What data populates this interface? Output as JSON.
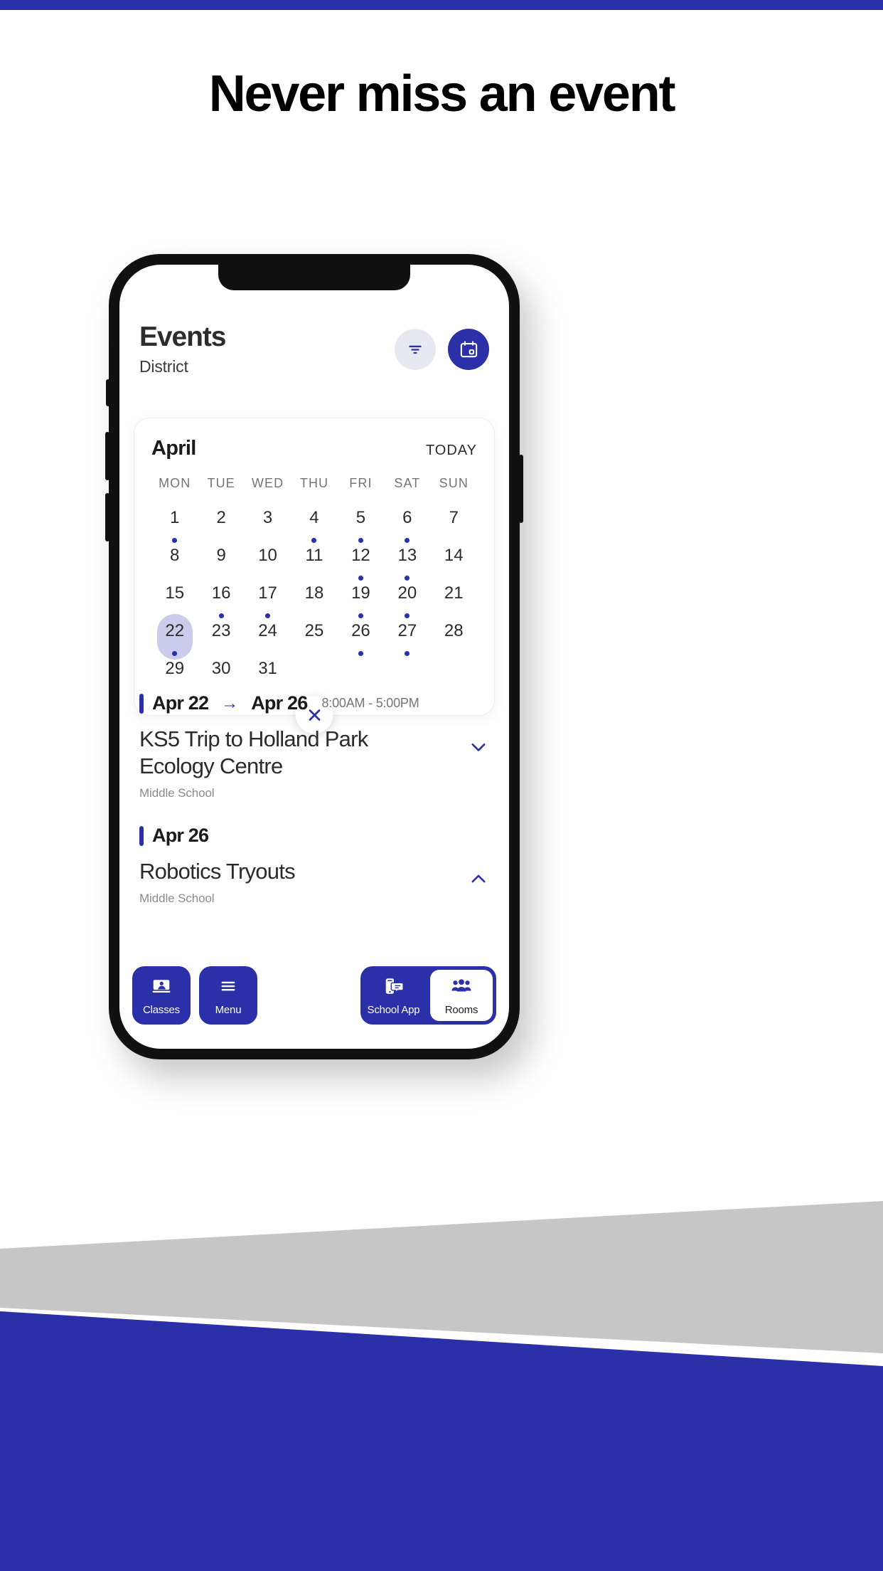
{
  "page": {
    "headline": "Never miss an event",
    "accent_blue": "#2b30a8",
    "selection_lavender": "#cbcceb",
    "band_gray": "#c6c6c6"
  },
  "app": {
    "title": "Events",
    "subtitle": "District",
    "actions": [
      {
        "name": "filter-icon",
        "style": "ghost"
      },
      {
        "name": "calendar-icon",
        "style": "solid"
      }
    ]
  },
  "calendar": {
    "month": "April",
    "today_label": "TODAY",
    "weekdays": [
      "MON",
      "TUE",
      "WED",
      "THU",
      "FRI",
      "SAT",
      "SUN"
    ],
    "selected_day": 22,
    "days_with_events": [
      1,
      4,
      5,
      6,
      12,
      13,
      16,
      17,
      19,
      20,
      22,
      26,
      27
    ],
    "weeks": [
      [
        1,
        2,
        3,
        4,
        5,
        6,
        7
      ],
      [
        8,
        9,
        10,
        11,
        12,
        13,
        14
      ],
      [
        15,
        16,
        17,
        18,
        19,
        20,
        21
      ],
      [
        22,
        23,
        24,
        25,
        26,
        27,
        28
      ],
      [
        29,
        30,
        31,
        null,
        null,
        null,
        null
      ]
    ],
    "close_label": "×"
  },
  "events": [
    {
      "date_start": "Apr 22",
      "date_end": "Apr 26",
      "has_range": true,
      "arrow": "→",
      "time": "8:00AM  -  5:00PM",
      "title": "KS5 Trip to Holland Park Ecology Centre",
      "subtitle": "Middle School",
      "chevron": "down"
    },
    {
      "date_start": "Apr 26",
      "date_end": "",
      "has_range": false,
      "arrow": "",
      "time": "",
      "title": "Robotics Tryouts",
      "subtitle": "Middle School",
      "chevron": "up"
    }
  ],
  "bottom_nav": {
    "left": [
      {
        "label": "Classes",
        "icon": "presentation-icon",
        "active": false
      },
      {
        "label": "Menu",
        "icon": "hamburger-icon",
        "active": false
      }
    ],
    "right": [
      {
        "label": "School App",
        "icon": "phone-chat-icon",
        "active": false
      },
      {
        "label": "Rooms",
        "icon": "people-icon",
        "active": true
      }
    ]
  }
}
